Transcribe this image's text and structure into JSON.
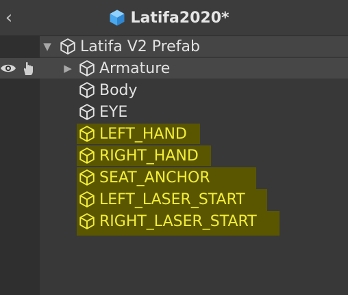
{
  "header": {
    "title": "Latifa2020*",
    "back_glyph": "‹",
    "title_icon": "cube-icon",
    "cube_color": "#55b7ff"
  },
  "hierarchy": {
    "root": {
      "label": "Latifa V2 Prefab",
      "expanded": true,
      "icon": "cube-outline-icon"
    },
    "children": [
      {
        "label": "Armature",
        "has_children": true,
        "highlighted": false,
        "icon": "cube-outline-icon"
      },
      {
        "label": "Body",
        "has_children": false,
        "highlighted": false,
        "icon": "cube-outline-icon"
      },
      {
        "label": "EYE",
        "has_children": false,
        "highlighted": false,
        "icon": "cube-outline-icon"
      },
      {
        "label": "LEFT_HAND",
        "has_children": false,
        "highlighted": true,
        "icon": "cube-outline-icon"
      },
      {
        "label": "RIGHT_HAND",
        "has_children": false,
        "highlighted": true,
        "icon": "cube-outline-icon"
      },
      {
        "label": "SEAT_ANCHOR",
        "has_children": false,
        "highlighted": true,
        "icon": "cube-outline-icon"
      },
      {
        "label": "LEFT_LASER_START",
        "has_children": false,
        "highlighted": true,
        "icon": "cube-outline-icon"
      },
      {
        "label": "RIGHT_LASER_START",
        "has_children": false,
        "highlighted": true,
        "icon": "cube-outline-icon"
      }
    ]
  },
  "gutter_icons": [
    "eye-icon",
    "hand-icon"
  ],
  "colors": {
    "background": "#383838",
    "text": "#e2e2e2",
    "highlight_text": "#f2ee3a",
    "highlight_bg": "#5a5600"
  }
}
